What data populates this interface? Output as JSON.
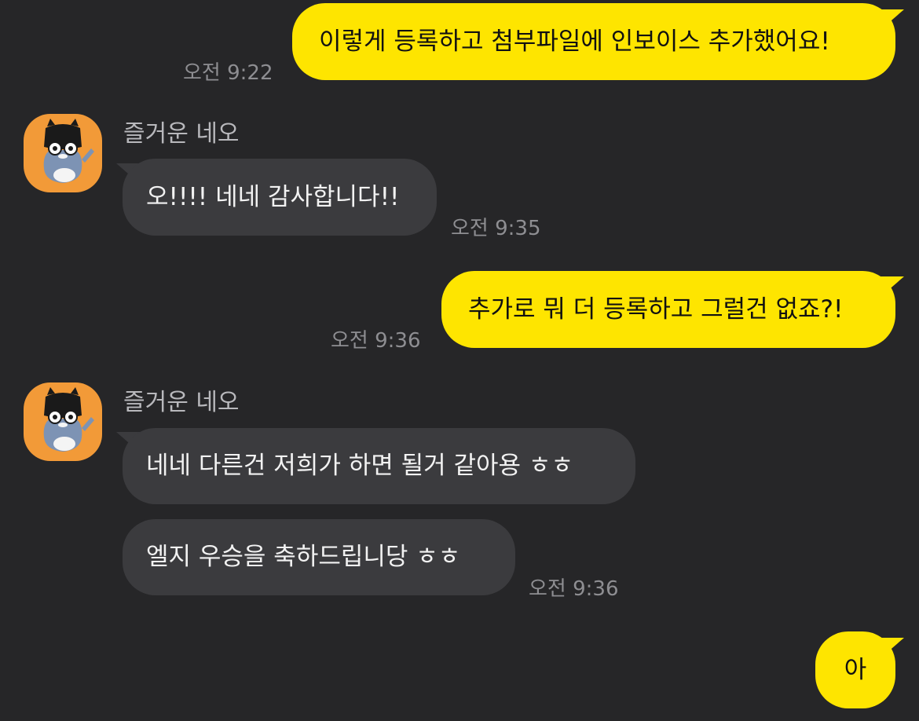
{
  "messages": [
    {
      "side": "me",
      "text": "이렇게 등록하고 첨부파일에 인보이스 추가했어요!",
      "time": "오전 9:22"
    },
    {
      "side": "them",
      "sender": "즐거운 네오",
      "text": "오!!!! 네네 감사합니다!!",
      "time": "오전 9:35"
    },
    {
      "side": "me",
      "text": "추가로 뭐 더 등록하고 그럴건 없죠?!",
      "time": "오전 9:36"
    },
    {
      "side": "them",
      "sender": "즐거운 네오",
      "text": "네네 다른건 저희가 하면 될거 같아용 ㅎㅎ"
    },
    {
      "side": "them",
      "text": "엘지 우승을 축하드립니당 ㅎㅎ",
      "time": "오전 9:36"
    },
    {
      "side": "me",
      "text": "아"
    }
  ],
  "avatar_icon": "neo-cat-character-icon",
  "colors": {
    "background": "#262628",
    "my_bubble": "#FEE500",
    "their_bubble": "#3B3B3E",
    "avatar_bg": "#F29A38"
  }
}
